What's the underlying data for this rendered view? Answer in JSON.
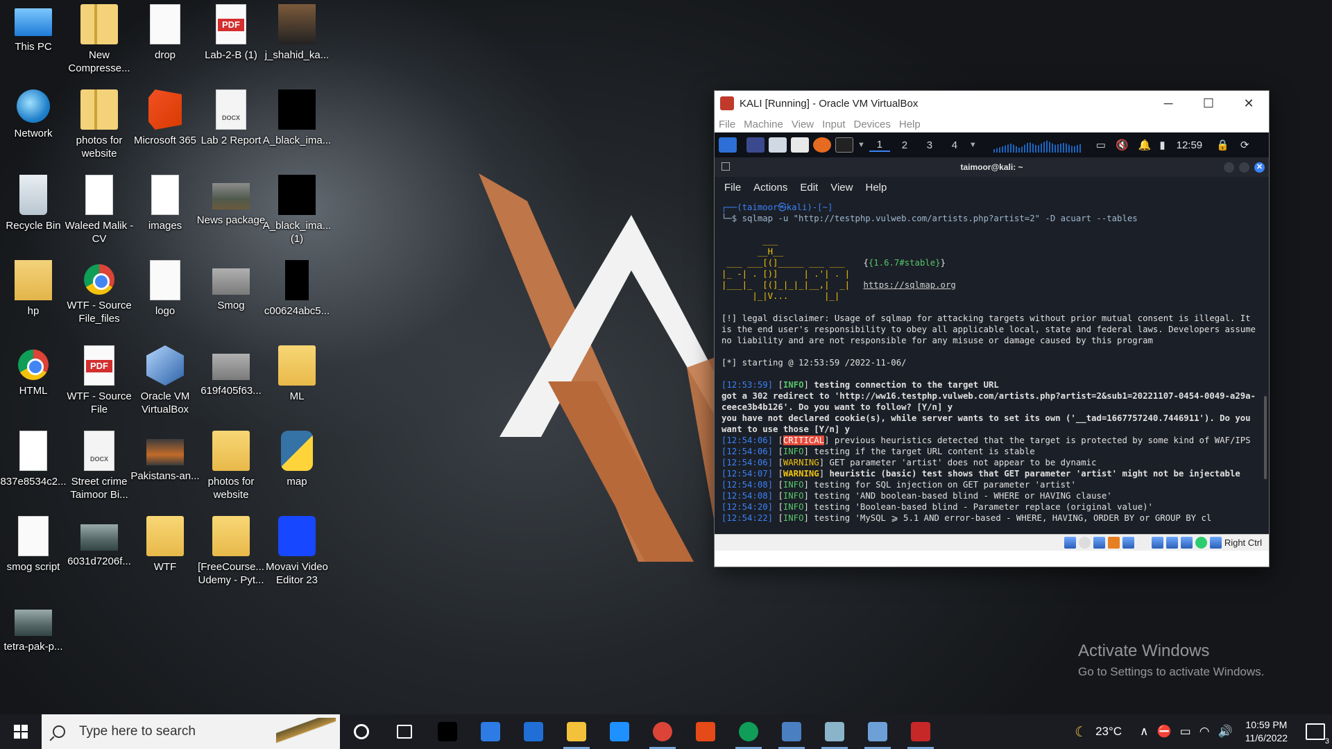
{
  "desktop": {
    "icons": [
      {
        "label": "This PC",
        "icon": "this-pc-icon"
      },
      {
        "label": "New Compresse...",
        "icon": "zip-folder-icon"
      },
      {
        "label": "drop",
        "icon": "blank-file-icon"
      },
      {
        "label": "Lab-2-B (1)",
        "icon": "pdf-file-icon"
      },
      {
        "label": "j_shahid_ka...",
        "icon": "image-file-icon"
      },
      {
        "label": "Network",
        "icon": "network-icon"
      },
      {
        "label": "photos for website",
        "icon": "zip-folder-icon"
      },
      {
        "label": "Microsoft 365",
        "icon": "microsoft-365-icon"
      },
      {
        "label": "Lab 2 Report",
        "icon": "docx-file-icon"
      },
      {
        "label": "A_black_ima...",
        "icon": "image-file-icon"
      },
      {
        "label": "Recycle Bin",
        "icon": "recycle-bin-icon"
      },
      {
        "label": "Waleed Malik - CV",
        "icon": "document-icon"
      },
      {
        "label": "images",
        "icon": "image-file-icon"
      },
      {
        "label": "News package",
        "icon": "image-file-icon"
      },
      {
        "label": "A_black_ima... (1)",
        "icon": "image-file-icon"
      },
      {
        "label": "hp",
        "icon": "user-folder-icon"
      },
      {
        "label": "WTF - Source File_files",
        "icon": "chrome-file-icon"
      },
      {
        "label": "logo",
        "icon": "image-file-icon"
      },
      {
        "label": "Smog",
        "icon": "image-file-icon"
      },
      {
        "label": "c00624abc5...",
        "icon": "image-file-icon"
      },
      {
        "label": "HTML",
        "icon": "chrome-file-icon"
      },
      {
        "label": "WTF - Source File",
        "icon": "pdf-file-icon"
      },
      {
        "label": "Oracle VM VirtualBox",
        "icon": "virtualbox-icon"
      },
      {
        "label": "619f405f63...",
        "icon": "image-file-icon"
      },
      {
        "label": "ML",
        "icon": "folder-icon"
      },
      {
        "label": "837e8534c2...",
        "icon": "image-file-icon"
      },
      {
        "label": "Street crime Taimoor Bi...",
        "icon": "docx-file-icon"
      },
      {
        "label": "Pakistans-an...",
        "icon": "image-file-icon"
      },
      {
        "label": "photos for website",
        "icon": "folder-icon"
      },
      {
        "label": "map",
        "icon": "python-file-icon"
      },
      {
        "label": "smog script",
        "icon": "blank-file-icon"
      },
      {
        "label": "6031d7206f...",
        "icon": "image-file-icon"
      },
      {
        "label": "WTF",
        "icon": "folder-icon"
      },
      {
        "label": "[FreeCourse... Udemy - Pyt...",
        "icon": "folder-icon"
      },
      {
        "label": "Movavi Video Editor 23",
        "icon": "movavi-icon"
      },
      {
        "label": "tetra-pak-p...",
        "icon": "image-file-icon"
      }
    ]
  },
  "watermark": {
    "line1": "Activate Windows",
    "line2": "Go to Settings to activate Windows."
  },
  "vbox": {
    "title": "KALI [Running] - Oracle VM VirtualBox",
    "menu": [
      "File",
      "Machine",
      "View",
      "Input",
      "Devices",
      "Help"
    ],
    "status_host_key": "Right Ctrl"
  },
  "kali": {
    "workspaces": [
      "1",
      "2",
      "3",
      "4"
    ],
    "clock": "12:59",
    "terminal_title": "taimoor@kali: ~",
    "terminal_menu": [
      "File",
      "Actions",
      "Edit",
      "View",
      "Help"
    ],
    "prompt_user": "┌──(taimoor㉿kali)-[~]",
    "prompt_cmd": "└─$ sqlmap -u \"http://testphp.vulweb.com/artists.php?artist=2\" -D acuart --tables",
    "banner": [
      "        ___",
      "       __H__",
      " ___ ___[(]_____ ___ ___  ",
      "|_ -| . [)]     | .'| . |",
      "|___|_  [(]_|_|_|__,|  _|",
      "      |_|V...       |_|   "
    ],
    "version": "{1.6.7#stable}",
    "site": "https://sqlmap.org",
    "disclaimer": "[!] legal disclaimer: Usage of sqlmap for attacking targets without prior mutual consent is illegal. It is the end user's responsibility to obey all applicable local, state and federal laws. Developers assume no liability and are not responsible for any misuse or damage caused by this program",
    "starting": "[*] starting @ 12:53:59 /2022-11-06/",
    "log": [
      {
        "time": "[12:53:59]",
        "level": "INFO",
        "msg": "testing connection to the target URL",
        "bold": true
      },
      {
        "time": "",
        "level": "",
        "msg": "got a 302 redirect to 'http://ww16.testphp.vulweb.com/artists.php?artist=2&sub1=20221107-0454-0049-a29a-ceece3b4b126'. Do you want to follow? [Y/n] y",
        "bold": true
      },
      {
        "time": "",
        "level": "",
        "msg": "you have not declared cookie(s), while server wants to set its own ('__tad=1667757240.7446911'). Do you want to use those [Y/n] y",
        "bold": true
      },
      {
        "time": "[12:54:06]",
        "level": "CRITICAL",
        "msg": "previous heuristics detected that the target is protected by some kind of WAF/IPS",
        "bold": false
      },
      {
        "time": "[12:54:06]",
        "level": "INFO",
        "msg": "testing if the target URL content is stable",
        "bold": false
      },
      {
        "time": "[12:54:06]",
        "level": "WARNING",
        "msg": "GET parameter 'artist' does not appear to be dynamic",
        "bold": false
      },
      {
        "time": "[12:54:07]",
        "level": "WARNING",
        "msg": "heuristic (basic) test shows that GET parameter 'artist' might not be injectable",
        "bold": true
      },
      {
        "time": "[12:54:08]",
        "level": "INFO",
        "msg": "testing for SQL injection on GET parameter 'artist'",
        "bold": false
      },
      {
        "time": "[12:54:08]",
        "level": "INFO",
        "msg": "testing 'AND boolean-based blind - WHERE or HAVING clause'",
        "bold": false
      },
      {
        "time": "[12:54:20]",
        "level": "INFO",
        "msg": "testing 'Boolean-based blind - Parameter replace (original value)'",
        "bold": false
      },
      {
        "time": "[12:54:22]",
        "level": "INFO",
        "msg": "testing 'MySQL ⩾ 5.1 AND error-based - WHERE, HAVING, ORDER BY or GROUP BY cl",
        "bold": false
      }
    ]
  },
  "taskbar": {
    "search_placeholder": "Type here to search",
    "apps": [
      "cortana-icon",
      "task-view-icon",
      "netflix-icon",
      "store-icon",
      "mail-icon",
      "file-explorer-icon",
      "app-w-icon",
      "chrome-icon",
      "office-icon",
      "chrome-profile-icon",
      "virtualbox-icon",
      "notepad-icon",
      "paint-icon",
      "debian-icon"
    ],
    "weather": "23°C",
    "time": "10:59 PM",
    "date": "11/6/2022",
    "notifications": "3"
  },
  "colors": {
    "taskbar": "#1a1c21",
    "kali_accent": "#3a82f7",
    "info": "#58c66b",
    "warning": "#f1c40f",
    "critical": "#e74c3c"
  }
}
